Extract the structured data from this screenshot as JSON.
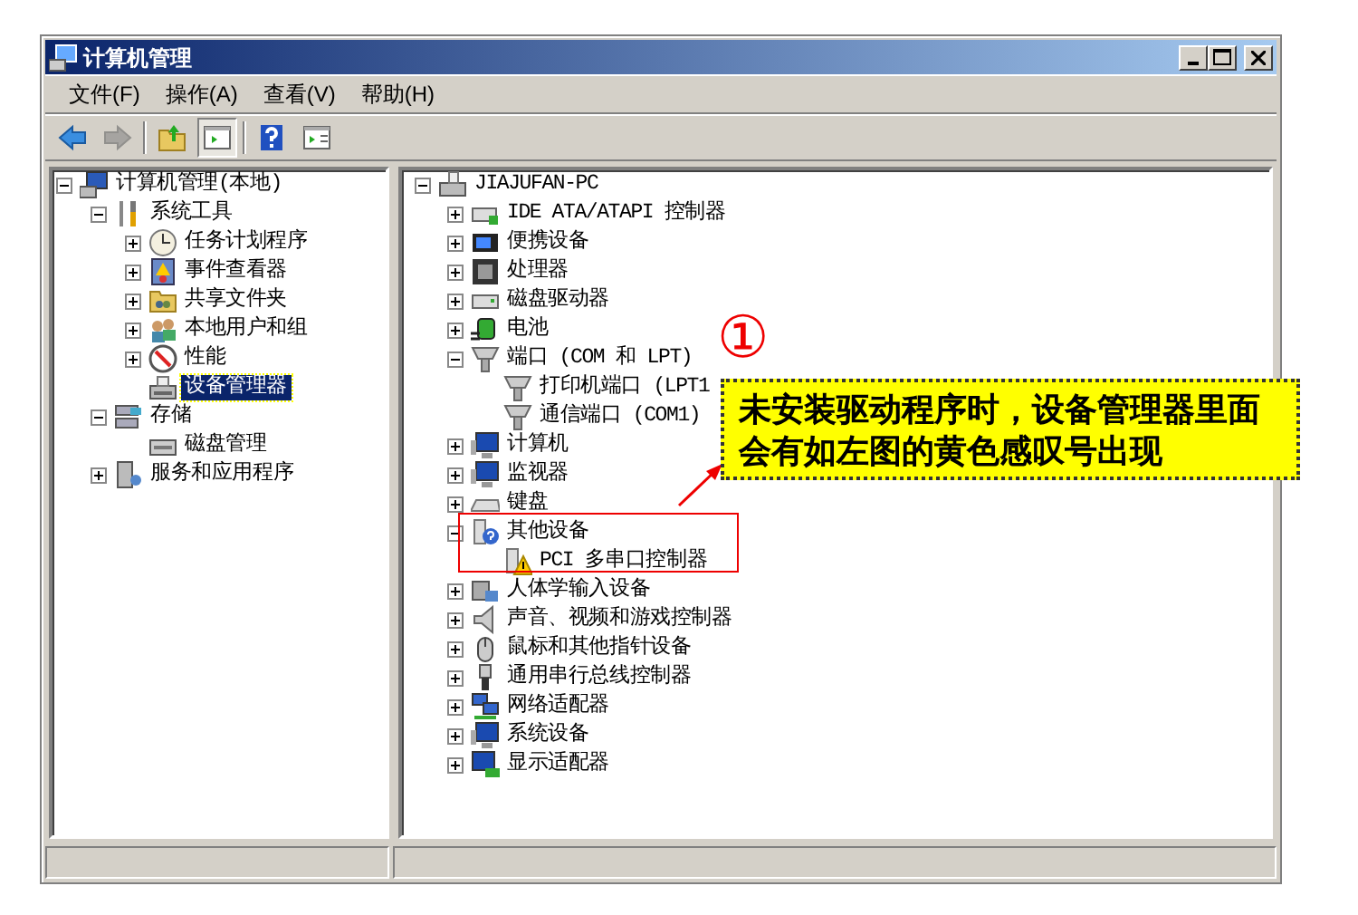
{
  "window": {
    "title": "计算机管理"
  },
  "menu": [
    "文件(F)",
    "操作(A)",
    "查看(V)",
    "帮助(H)"
  ],
  "toolbar": [
    {
      "kind": "back",
      "disabled": false,
      "pressed": false
    },
    {
      "kind": "forward",
      "disabled": true,
      "pressed": false
    },
    {
      "kind": "separator"
    },
    {
      "kind": "up",
      "disabled": false,
      "pressed": false
    },
    {
      "kind": "tree",
      "disabled": false,
      "pressed": true
    },
    {
      "kind": "separator"
    },
    {
      "kind": "help",
      "disabled": false,
      "pressed": false
    },
    {
      "kind": "action",
      "disabled": false,
      "pressed": false
    }
  ],
  "nav_tree": [
    {
      "label": "计算机管理(本地)",
      "kind": "computer",
      "selected": false,
      "expanded": true,
      "children": [
        {
          "label": "系统工具",
          "kind": "tools",
          "selected": false,
          "expanded": true,
          "children": [
            {
              "label": "任务计划程序",
              "kind": "clock",
              "selected": false,
              "expanded": false
            },
            {
              "label": "事件查看器",
              "kind": "event",
              "selected": false,
              "expanded": false
            },
            {
              "label": "共享文件夹",
              "kind": "share",
              "selected": false,
              "expanded": false
            },
            {
              "label": "本地用户和组",
              "kind": "users",
              "selected": false,
              "expanded": false
            },
            {
              "label": "性能",
              "kind": "perf",
              "selected": false,
              "expanded": false
            },
            {
              "label": "设备管理器",
              "kind": "devmgr",
              "selected": true
            }
          ]
        },
        {
          "label": "存储",
          "kind": "storage",
          "selected": false,
          "expanded": true,
          "children": [
            {
              "label": "磁盘管理",
              "kind": "disk",
              "selected": false
            }
          ]
        },
        {
          "label": "服务和应用程序",
          "kind": "services",
          "selected": false,
          "expanded": false
        }
      ]
    }
  ],
  "device_tree": [
    {
      "label": "JIAJUFAN-PC",
      "kind": "pc",
      "expanded": true,
      "children": [
        {
          "label": "IDE ATA/ATAPI 控制器",
          "kind": "ide",
          "expanded": false
        },
        {
          "label": "便携设备",
          "kind": "portable",
          "expanded": false
        },
        {
          "label": "处理器",
          "kind": "cpu",
          "expanded": false
        },
        {
          "label": "磁盘驱动器",
          "kind": "drive",
          "expanded": false
        },
        {
          "label": "电池",
          "kind": "battery",
          "expanded": false
        },
        {
          "label": "端口 (COM 和 LPT)",
          "kind": "port",
          "expanded": true,
          "children": [
            {
              "label": "打印机端口 (LPT1",
              "kind": "port"
            },
            {
              "label": "通信端口 (COM1)",
              "kind": "port"
            }
          ]
        },
        {
          "label": "计算机",
          "kind": "monitor",
          "expanded": false
        },
        {
          "label": "监视器",
          "kind": "monitor",
          "expanded": false
        },
        {
          "label": "键盘",
          "kind": "keyboard",
          "expanded": false
        },
        {
          "label": "其他设备",
          "kind": "other",
          "expanded": true,
          "children": [
            {
              "label": "PCI 多串口控制器",
              "kind": "warning"
            }
          ]
        },
        {
          "label": "人体学输入设备",
          "kind": "hid",
          "expanded": false
        },
        {
          "label": "声音、视频和游戏控制器",
          "kind": "sound",
          "expanded": false
        },
        {
          "label": "鼠标和其他指针设备",
          "kind": "mouse",
          "expanded": false
        },
        {
          "label": "通用串行总线控制器",
          "kind": "usb",
          "expanded": false
        },
        {
          "label": "网络适配器",
          "kind": "network",
          "expanded": false
        },
        {
          "label": "系统设备",
          "kind": "monitor",
          "expanded": false
        },
        {
          "label": "显示适配器",
          "kind": "display",
          "expanded": false
        }
      ]
    }
  ],
  "callout": {
    "number": "①",
    "text": "未安装驱动程序时，设备管理器里面会有如左图的黄色感叹号出现"
  }
}
